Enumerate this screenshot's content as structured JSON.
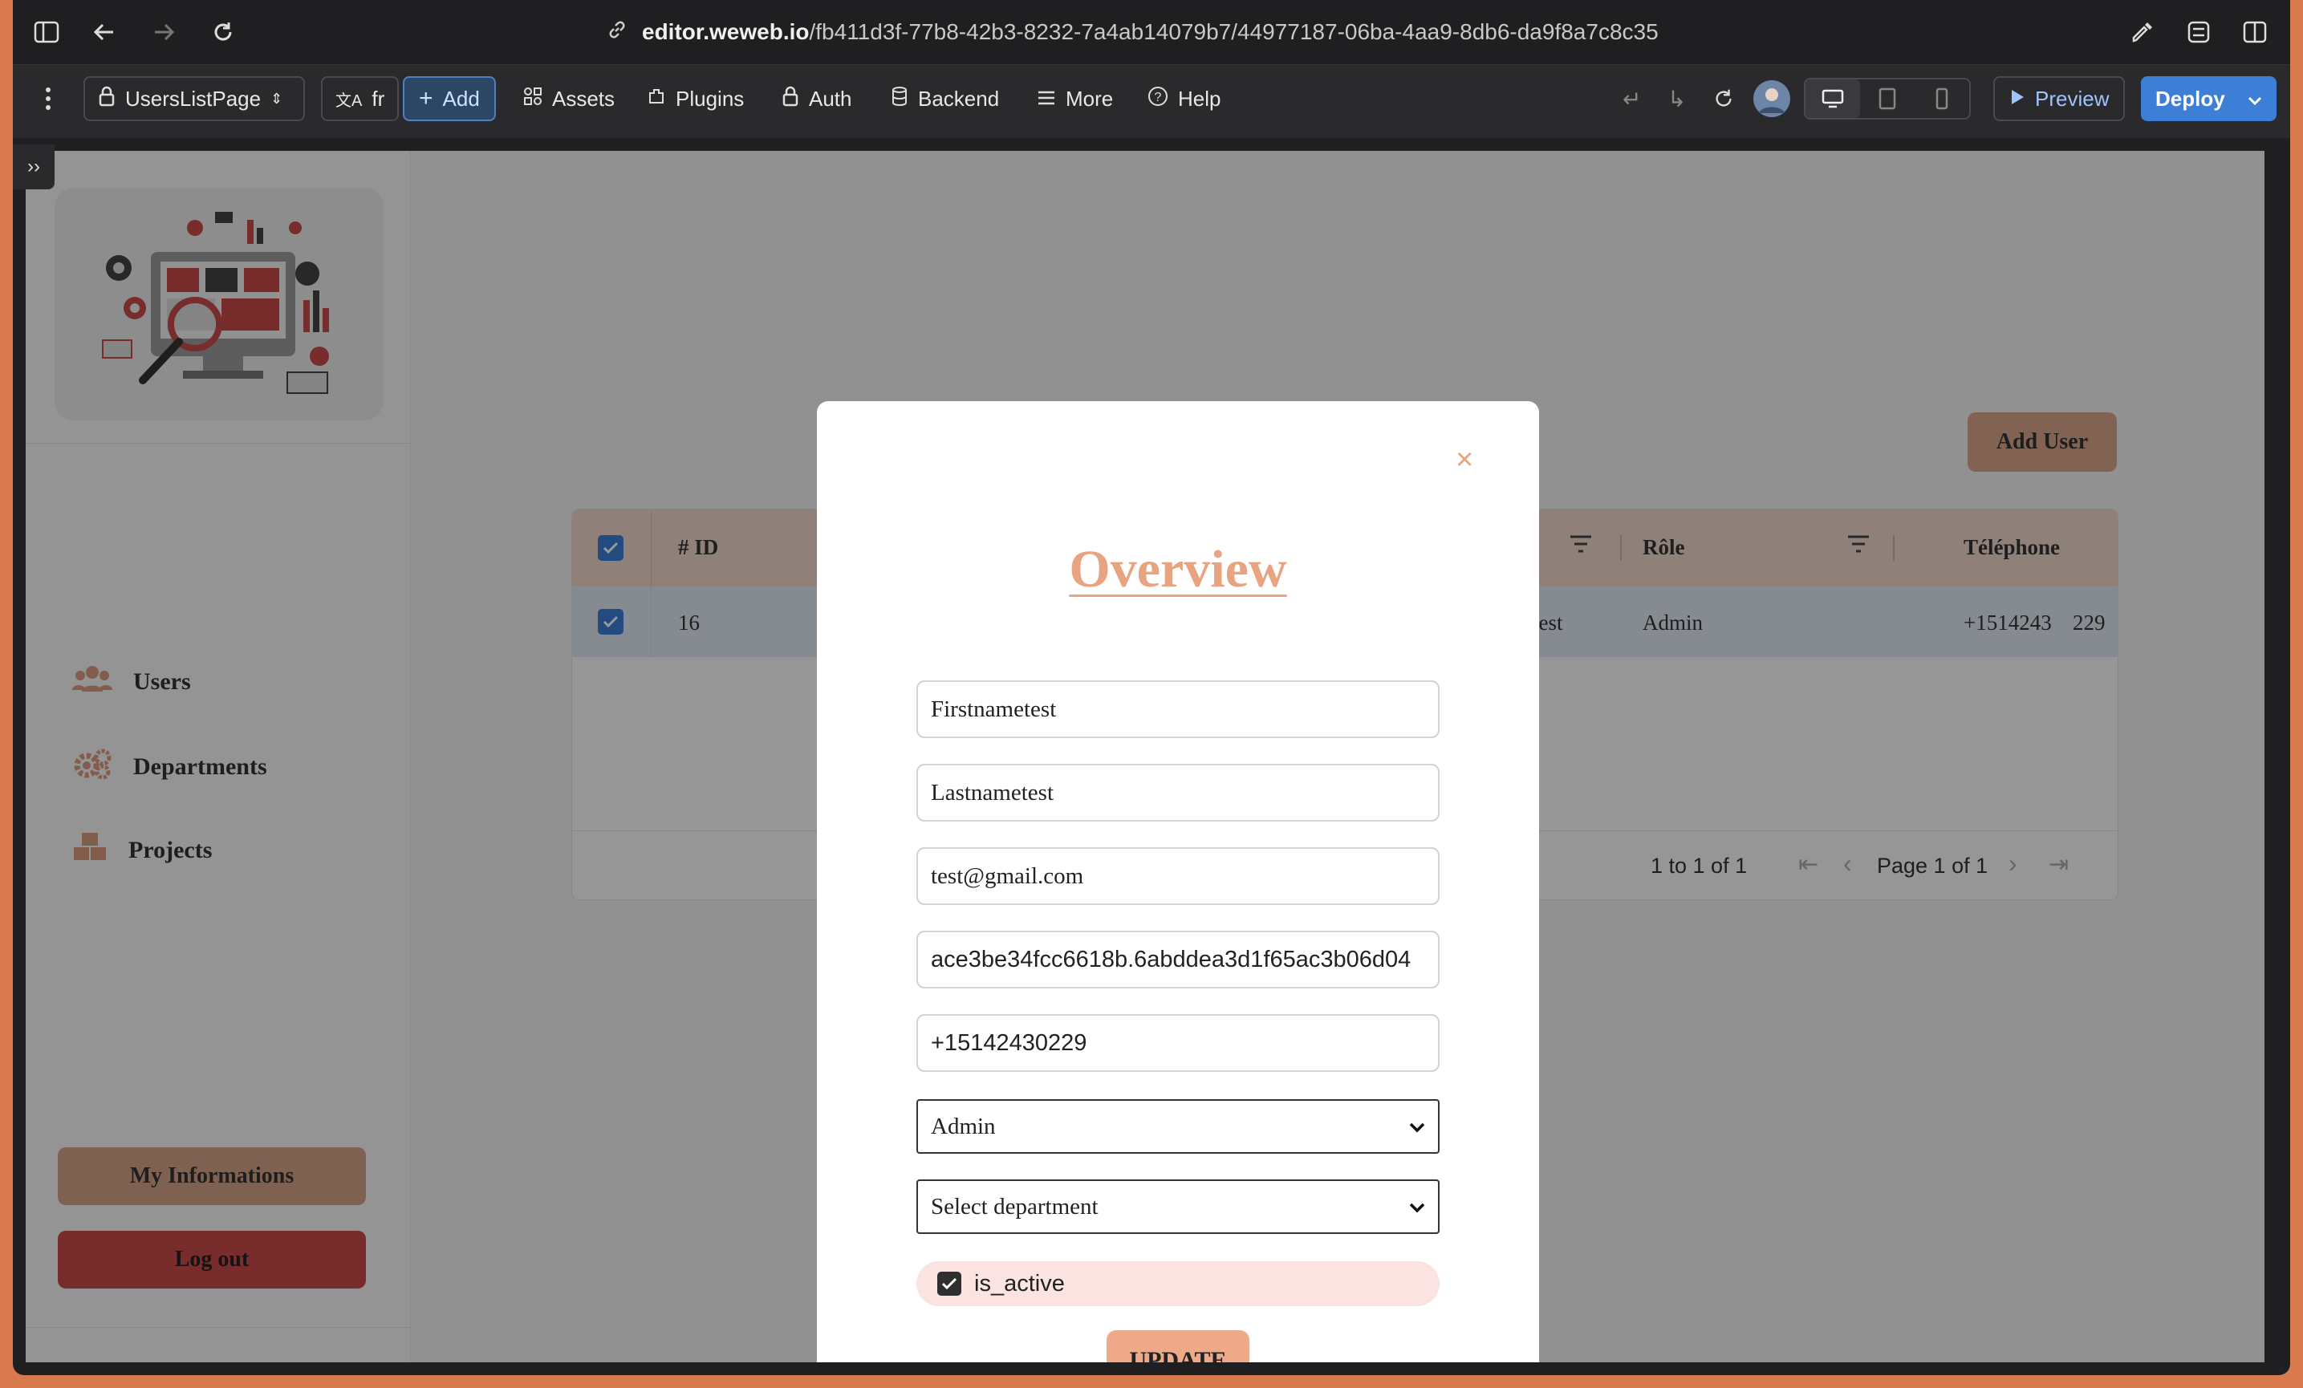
{
  "browser": {
    "url_host": "editor.weweb.io",
    "url_path": "/fb411d3f-77b8-42b3-8232-7a4ab14079b7/44977187-06ba-4aa9-8db6-da9f8a7c8c35"
  },
  "editor_toolbar": {
    "page_selector": "UsersListPage",
    "language": "fr",
    "add_label": "Add",
    "assets_label": "Assets",
    "plugins_label": "Plugins",
    "auth_label": "Auth",
    "backend_label": "Backend",
    "more_label": "More",
    "help_label": "Help",
    "preview_label": "Preview",
    "deploy_label": "Deploy"
  },
  "sidebar": {
    "items": [
      {
        "label": "Users",
        "icon": "users-icon"
      },
      {
        "label": "Departments",
        "icon": "gears-icon"
      },
      {
        "label": "Projects",
        "icon": "boxes-icon"
      }
    ],
    "my_info_label": "My  Informations",
    "logout_label": "Log  out"
  },
  "main": {
    "add_user_label": "Add  User",
    "table": {
      "headers": {
        "id": "# ID",
        "role": "Rôle",
        "phone": "Téléphone"
      },
      "row": {
        "id": "16",
        "name_tail": "metest",
        "role": "Admin",
        "phone": "+1514243",
        "phone_tail": "229"
      },
      "footer_range": "1 to 1 of 1",
      "footer_page": "Page 1 of 1"
    }
  },
  "modal": {
    "close_glyph": "×",
    "title": "Overview",
    "firstname": "Firstnametest",
    "lastname": "Lastnametest",
    "email": "test@gmail.com",
    "hash": "ace3be34fcc6618b.6abddea3d1f65ac3b06d04",
    "phone": "+15142430229",
    "role_selected": "Admin",
    "department_placeholder": "Select  department",
    "is_active_label": "is_active",
    "is_active": true,
    "update_label": "UPDATE"
  },
  "colors": {
    "accent": "#e8a381",
    "deploy": "#3d7fd6",
    "logout": "#c94a4a"
  }
}
